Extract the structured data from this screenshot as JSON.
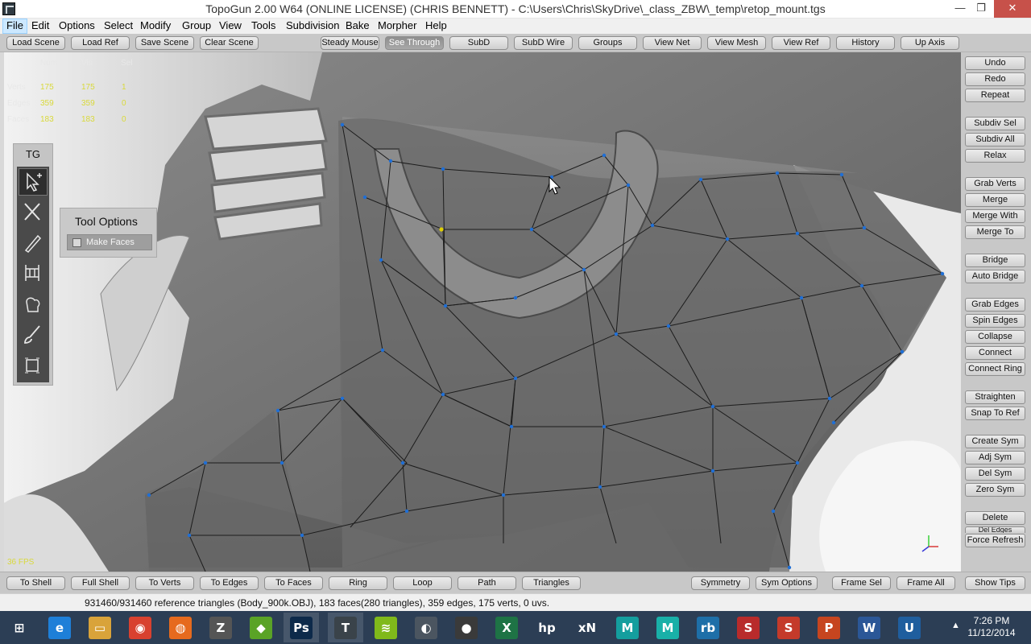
{
  "window": {
    "title": "TopoGun 2.00 W64  (ONLINE LICENSE) (CHRIS BENNETT) - C:\\Users\\Chris\\SkyDrive\\_class_ZBW\\_temp\\retop_mount.tgs",
    "minimize": "—",
    "maximize": "❐",
    "close": "✕"
  },
  "menu": [
    "File",
    "Edit",
    "Options",
    "Select",
    "Modify",
    "Group",
    "View",
    "Tools",
    "Subdivision",
    "Bake",
    "Morpher",
    "Help"
  ],
  "top_toolbar": {
    "left": [
      "Load Scene",
      "Load Ref",
      "Save Scene",
      "Clear Scene"
    ],
    "right": [
      "Steady Mouse",
      "See Through",
      "SubD",
      "SubD Wire",
      "Groups",
      "View Net",
      "View Mesh",
      "View Ref",
      "History",
      "Up Axis"
    ]
  },
  "stats": {
    "headers": [
      "Num",
      "Vis",
      "Sel"
    ],
    "rows": [
      {
        "label": "Verts",
        "num": "175",
        "vis": "175",
        "sel": "1"
      },
      {
        "label": "Edges",
        "num": "359",
        "vis": "359",
        "sel": "0"
      },
      {
        "label": "Faces",
        "num": "183",
        "vis": "183",
        "sel": "0"
      }
    ],
    "fps": "36 FPS"
  },
  "tool_panel": {
    "title": "TG",
    "tools": [
      "select-tool-icon",
      "cut-tool-icon",
      "draw-tool-icon",
      "bridge-tool-icon",
      "brush-tool-icon",
      "paint-tool-icon",
      "frame-tool-icon"
    ]
  },
  "tool_options": {
    "title": "Tool Options",
    "make_faces_label": "Make Faces",
    "make_faces_checked": false
  },
  "right_panel": [
    "Undo",
    "Redo",
    "Repeat",
    "Subdiv Sel",
    "Subdiv All",
    "Relax",
    "Grab Verts",
    "Merge",
    "Merge With",
    "Merge To",
    "Bridge",
    "Auto Bridge",
    "Grab Edges",
    "Spin Edges",
    "Collapse",
    "Connect",
    "Connect Ring",
    "Straighten",
    "Snap To Ref",
    "Create Sym",
    "Adj Sym",
    "Del Sym",
    "Zero Sym",
    "Delete",
    "Del Edges",
    "Force Refresh"
  ],
  "bottom_toolbar": {
    "left": [
      "To Shell",
      "Full Shell",
      "To Verts",
      "To Edges",
      "To Faces",
      "Ring",
      "Loop",
      "Path",
      "Triangles"
    ],
    "right": [
      "Symmetry",
      "Sym Options",
      "Frame Sel",
      "Frame All",
      "Show Tips"
    ]
  },
  "status": "931460/931460 reference triangles (Body_900k.OBJ), 183 faces(280 triangles), 359 edges, 175 verts, 0 uvs.",
  "taskbar": {
    "apps": [
      {
        "name": "windows-start-icon",
        "glyph": "⊞",
        "color": "#2c3e55"
      },
      {
        "name": "internet-explorer-icon",
        "glyph": "e",
        "color": "#1e7fd8"
      },
      {
        "name": "file-explorer-icon",
        "glyph": "▭",
        "color": "#d9a33a"
      },
      {
        "name": "chrome-icon",
        "glyph": "◉",
        "color": "#d8412f"
      },
      {
        "name": "firefox-icon",
        "glyph": "◍",
        "color": "#e66a1e"
      },
      {
        "name": "zbrush-icon",
        "glyph": "Z",
        "color": "#555555"
      },
      {
        "name": "nvidia-icon",
        "glyph": "◆",
        "color": "#5aa326"
      },
      {
        "name": "photoshop-icon",
        "glyph": "Ps",
        "color": "#0d2a4a"
      },
      {
        "name": "topogun-icon",
        "glyph": "T",
        "color": "#3a434a"
      },
      {
        "name": "spotify-icon",
        "glyph": "≋",
        "color": "#80b91b"
      },
      {
        "name": "app-icon",
        "glyph": "◐",
        "color": "#4b5560"
      },
      {
        "name": "mudbox-icon",
        "glyph": "●",
        "color": "#3a3a3a"
      },
      {
        "name": "excel-icon",
        "glyph": "X",
        "color": "#1e7345"
      },
      {
        "name": "hp-icon",
        "glyph": "hp",
        "color": "#2c3e55"
      },
      {
        "name": "xnormal-icon",
        "glyph": "xN",
        "color": "#2c3e55"
      },
      {
        "name": "maya-lt-icon",
        "glyph": "M",
        "color": "#149e9e"
      },
      {
        "name": "maya-icon",
        "glyph": "M",
        "color": "#19b0a8"
      },
      {
        "name": "rb-icon",
        "glyph": "rb",
        "color": "#1e6fa8"
      },
      {
        "name": "substance-icon",
        "glyph": "S",
        "color": "#b82b2b"
      },
      {
        "name": "substance-designer-icon",
        "glyph": "S",
        "color": "#c43a2a"
      },
      {
        "name": "powerpoint-icon",
        "glyph": "P",
        "color": "#c6451f"
      },
      {
        "name": "word-icon",
        "glyph": "W",
        "color": "#2b5797"
      },
      {
        "name": "unreal-icon",
        "glyph": "U",
        "color": "#1f5e9e"
      }
    ],
    "tray_arrow": "▲",
    "time": "7:26 PM",
    "date": "11/12/2014"
  },
  "colors": {
    "stat_values": "#d9d93a",
    "vertex": "#1f6fd6",
    "selected_vertex": "#e0d000",
    "close_button": "#c7514a",
    "taskbar": "#2c3e55"
  }
}
